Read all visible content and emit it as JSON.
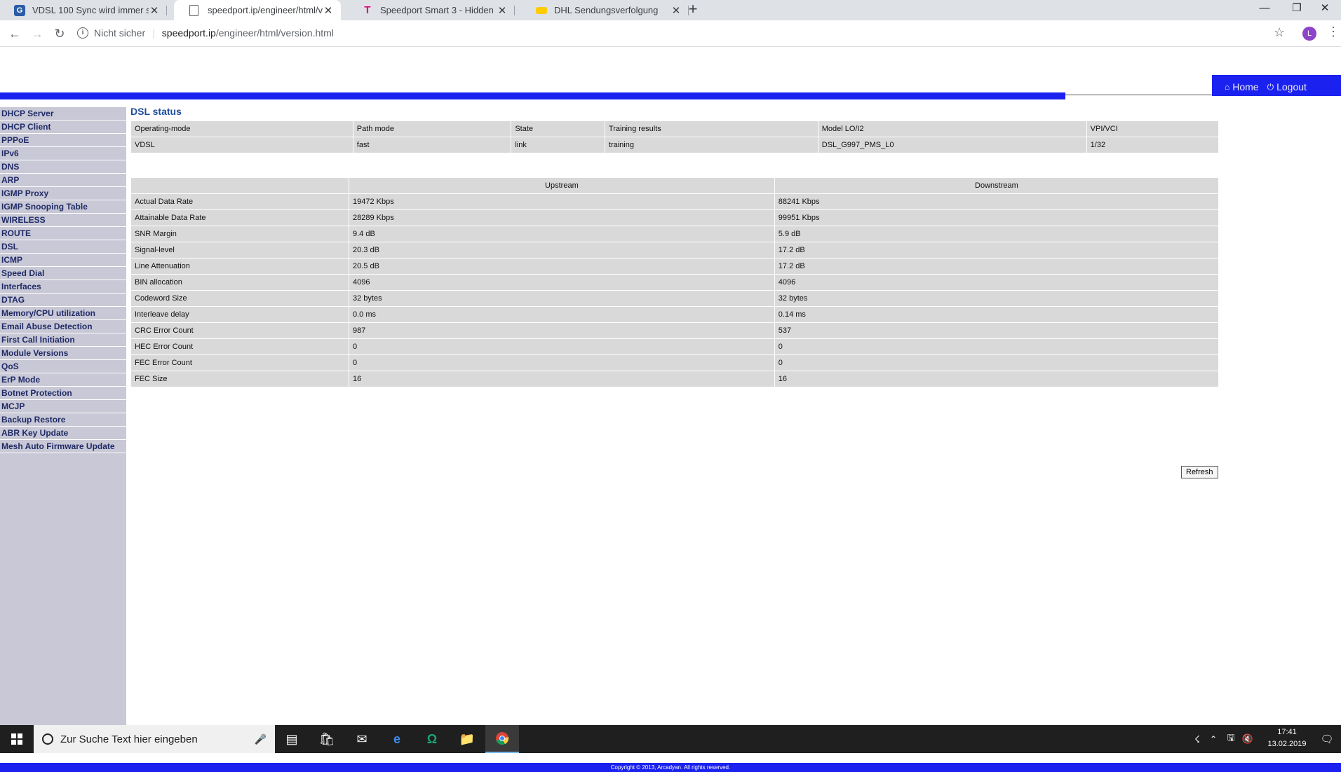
{
  "browser": {
    "tabs": [
      {
        "title": "VDSL 100 Sync wird immer schle",
        "icon": "forum-icon",
        "color": "#2a5ca8",
        "active": false
      },
      {
        "title": "speedport.ip/engineer/html/vers",
        "icon": "document-icon",
        "color": "#ffffff",
        "active": true
      },
      {
        "title": "Speedport Smart 3 - Hidden Me",
        "icon": "telekom-icon",
        "color": "#e20074",
        "active": false
      },
      {
        "title": "DHL Sendungsverfolgung",
        "icon": "dhl-icon",
        "color": "#ffcc00",
        "active": false
      }
    ],
    "new_tab": "+",
    "address": {
      "security_label": "Nicht sicher",
      "host": "speedport.ip",
      "path": "/engineer/html/version.html"
    },
    "profile_initial": "L"
  },
  "topnav": {
    "home_label": "Home",
    "logout_label": "Logout"
  },
  "sidebar": {
    "items": [
      "DHCP Server",
      "DHCP Client",
      "PPPoE",
      "IPv6",
      "DNS",
      "ARP",
      "IGMP Proxy",
      "IGMP Snooping Table",
      "WIRELESS",
      "ROUTE",
      "DSL",
      "ICMP",
      "Speed Dial",
      "Interfaces",
      "DTAG",
      "Memory/CPU utilization",
      "Email Abuse Detection",
      "First Call Initiation",
      "Module Versions",
      "QoS",
      "ErP Mode",
      "Botnet Protection",
      "MCJP",
      "Backup Restore",
      "ABR Key Update",
      "Mesh Auto Firmware Update"
    ]
  },
  "main": {
    "title": "DSL status",
    "status_table": {
      "headers": [
        "Operating-mode",
        "Path mode",
        "State",
        "Training results",
        "Model LO/I2",
        "VPI/VCI"
      ],
      "row": [
        "VDSL",
        "fast",
        "link",
        "training",
        "DSL_G997_PMS_L0",
        "1/32"
      ]
    },
    "rate_table": {
      "headers": [
        "",
        "Upstream",
        "Downstream"
      ],
      "rows": [
        [
          "Actual Data Rate",
          "19472 Kbps",
          "88241 Kbps"
        ],
        [
          "Attainable Data Rate",
          "28289 Kbps",
          "99951 Kbps"
        ],
        [
          "SNR Margin",
          "9.4 dB",
          "5.9 dB"
        ],
        [
          "Signal-level",
          "20.3 dB",
          "17.2 dB"
        ],
        [
          "Line Attenuation",
          "20.5 dB",
          "17.2 dB"
        ],
        [
          "BIN allocation",
          "4096",
          "4096"
        ],
        [
          "Codeword Size",
          "32 bytes",
          "32 bytes"
        ],
        [
          "Interleave delay",
          "0.0 ms",
          "0.14 ms"
        ],
        [
          "CRC Error Count",
          "987",
          "537"
        ],
        [
          "HEC Error Count",
          "0",
          "0"
        ],
        [
          "FEC Error Count",
          "0",
          "0"
        ],
        [
          "FEC Size",
          "16",
          "16"
        ]
      ]
    },
    "refresh_label": "Refresh"
  },
  "footer": {
    "text": "Copyright © 2013, Arcadyan. All rights reserved."
  },
  "taskbar": {
    "search_placeholder": "Zur Suche Text hier eingeben",
    "time": "17:41",
    "date": "13.02.2019"
  },
  "colors": {
    "accent_blue": "#1b22f0",
    "sidebar_bg": "#c8c8d6",
    "sidebar_text": "#1f2a66",
    "table_cell": "#d9d9d9"
  }
}
